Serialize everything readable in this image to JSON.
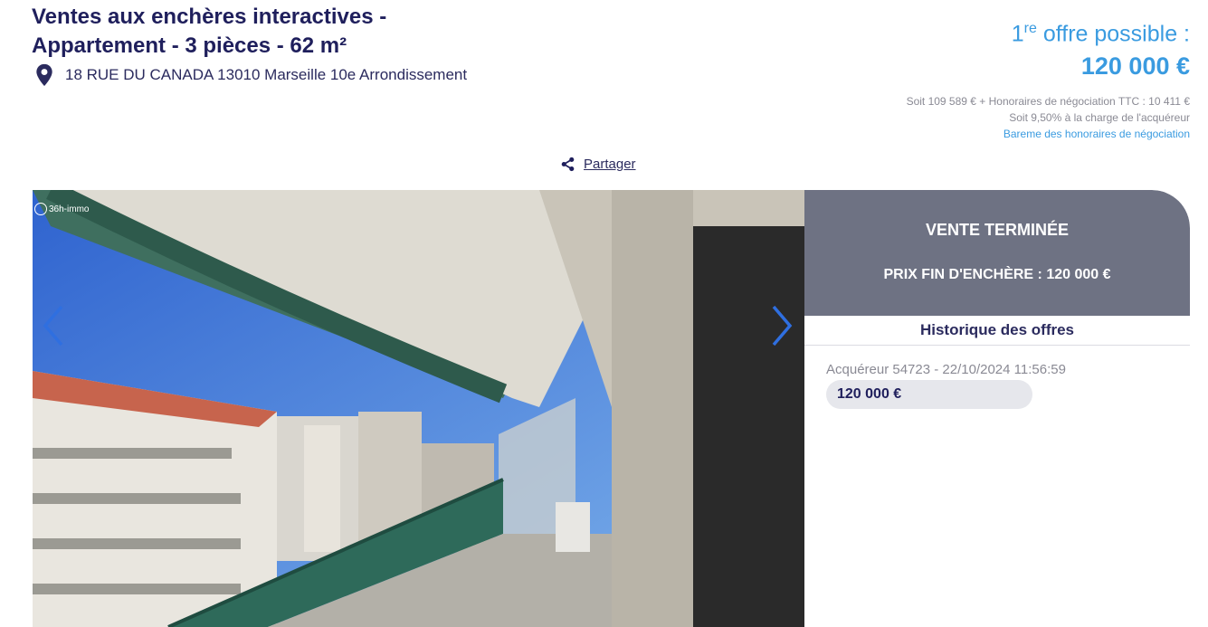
{
  "header": {
    "title_line1": "Ventes aux enchères interactives -",
    "title_line2": "Appartement - 3 pièces - 62 m²",
    "address": "18 RUE DU CANADA 13010 Marseille 10e Arrondissement"
  },
  "offer": {
    "ordinal_number": "1",
    "ordinal_suffix": "re",
    "label": " offre possible :",
    "price": "120 000 €",
    "fee_line1": "Soit 109 589 € + Honoraires de négociation TTC : 10 411 €",
    "fee_line2": "Soit 9,50% à la charge de l'acquéreur",
    "fee_link": "Bareme des honoraires de négociation"
  },
  "share": {
    "label": "Partager",
    "icon": "share-icon"
  },
  "gallery": {
    "watermark": "36h-immo",
    "prev_icon": "chevron-left-icon",
    "next_icon": "chevron-right-icon"
  },
  "status": {
    "state": "VENTE TERMINÉE",
    "final_price": "PRIX FIN D'ENCHÈRE : 120 000 €"
  },
  "history": {
    "title": "Historique des offres",
    "bids": [
      {
        "meta": "Acquéreur 54723 - 22/10/2024 11:56:59",
        "amount": "120 000 €"
      }
    ]
  },
  "colors": {
    "navy": "#1f1f5c",
    "accent": "#3a9be0",
    "status_bg": "#6e7283",
    "chip_bg": "#e6e7ec"
  }
}
